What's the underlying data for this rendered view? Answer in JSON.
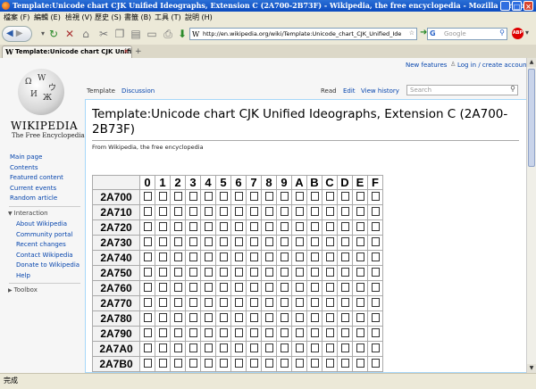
{
  "window": {
    "title": "Template:Unicode chart CJK Unified Ideographs, Extension C (2A700-2B73F) - Wikipedia, the free encyclopedia - Mozilla Firefox",
    "controls": [
      "_",
      "□",
      "×"
    ]
  },
  "menubar": {
    "items": [
      "檔案 (F)",
      "編輯 (E)",
      "檢視 (V)",
      "歷史 (S)",
      "書籤 (B)",
      "工具 (T)",
      "說明 (H)"
    ]
  },
  "toolbar": {
    "url": "http://en.wikipedia.org/wiki/Template:Unicode_chart_CJK_Unified_Ideographs...",
    "search_engine": "G",
    "search_placeholder": "Google",
    "adblock_label": "ABP"
  },
  "tabs": [
    {
      "label": "Template:Unicode chart CJK Unifie…",
      "favicon": "W"
    }
  ],
  "personal": {
    "new_features": "New features",
    "login": "Log in / create account"
  },
  "sidebar": {
    "logo_word": "WIKIPEDIA",
    "logo_tagline": "The Free Encyclopedia",
    "nav": [
      "Main page",
      "Contents",
      "Featured content",
      "Current events",
      "Random article"
    ],
    "interaction_heading": "Interaction",
    "interaction": [
      "About Wikipedia",
      "Community portal",
      "Recent changes",
      "Contact Wikipedia",
      "Donate to Wikipedia",
      "Help"
    ],
    "toolbox_heading": "Toolbox"
  },
  "page_tabs": {
    "template": "Template",
    "discussion": "Discussion",
    "read": "Read",
    "edit": "Edit",
    "history": "View history",
    "search_placeholder": "Search"
  },
  "article": {
    "title": "Template:Unicode chart CJK Unified Ideographs, Extension C (2A700-2B73F)",
    "subtitle": "From Wikipedia, the free encyclopedia"
  },
  "chart_table": {
    "columns": [
      "0",
      "1",
      "2",
      "3",
      "4",
      "5",
      "6",
      "7",
      "8",
      "9",
      "A",
      "B",
      "C",
      "D",
      "E",
      "F"
    ],
    "rows": [
      "2A700",
      "2A710",
      "2A720",
      "2A730",
      "2A740",
      "2A750",
      "2A760",
      "2A770",
      "2A780",
      "2A790",
      "2A7A0",
      "2A7B0"
    ]
  },
  "status": {
    "text": "完成"
  }
}
